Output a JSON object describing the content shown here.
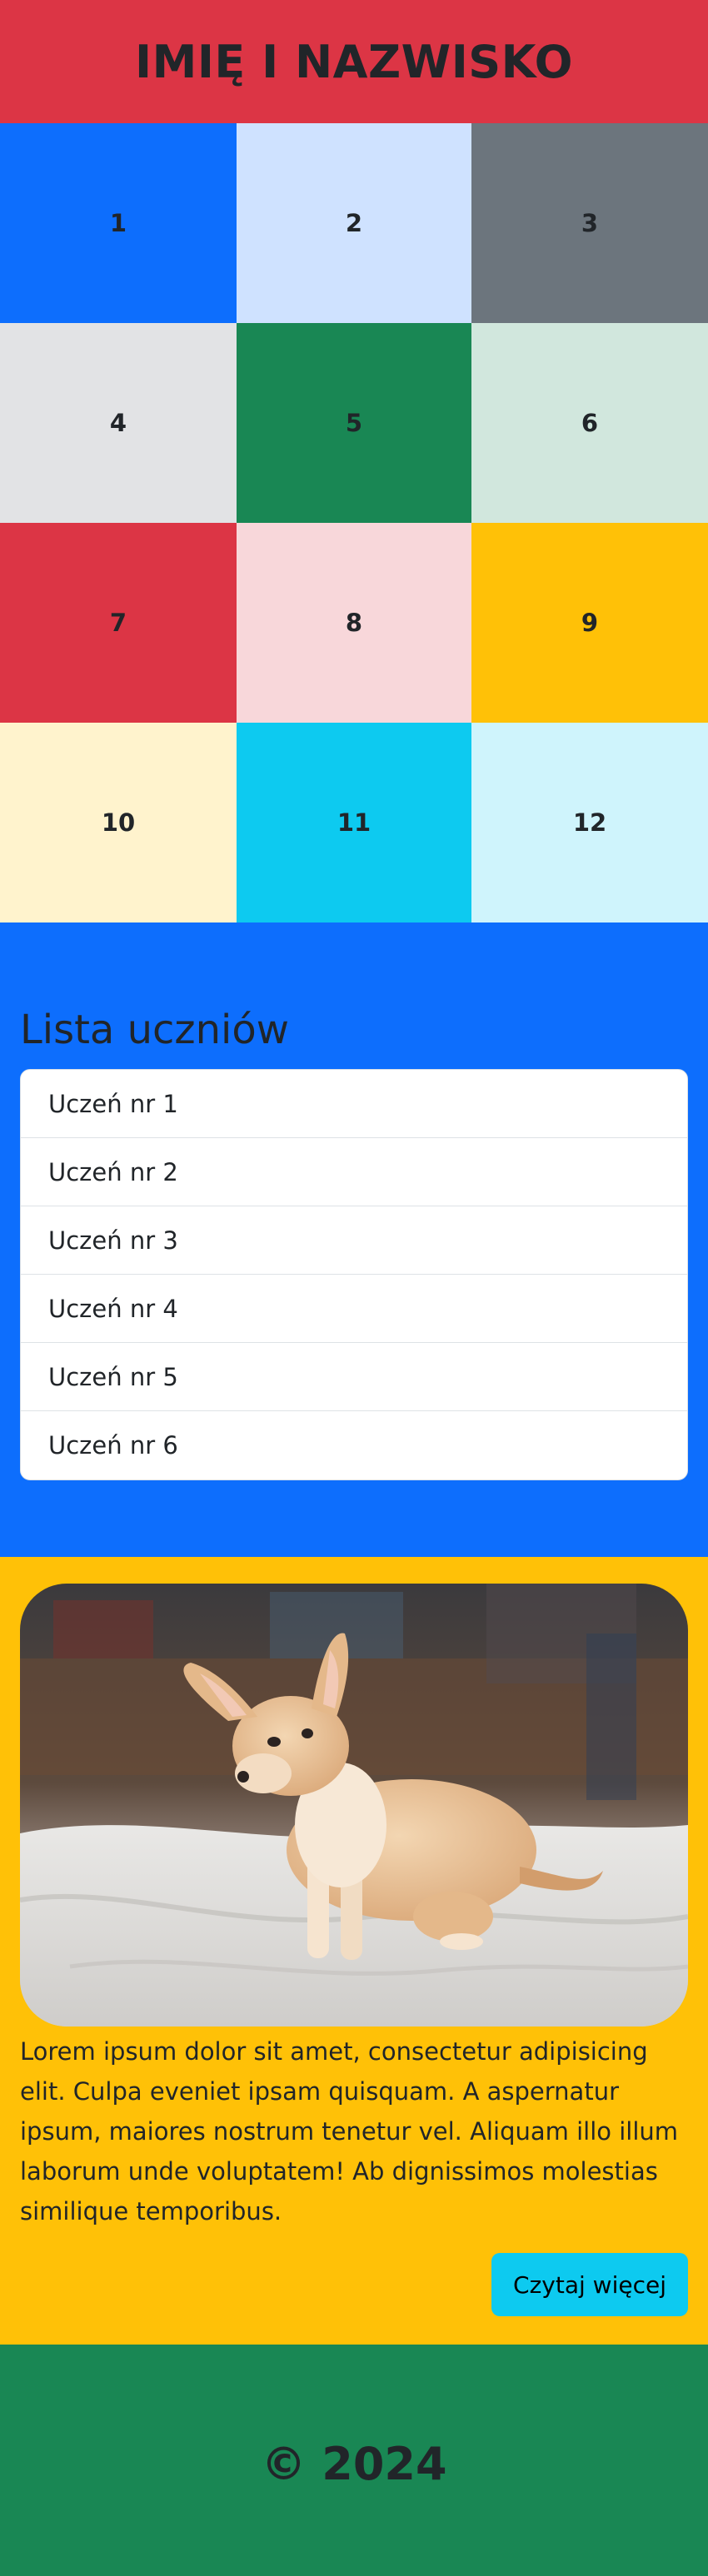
{
  "header": {
    "title": "IMIĘ I NAZWISKO"
  },
  "grid": {
    "cells": [
      {
        "label": "1",
        "color": "#0d6efd"
      },
      {
        "label": "2",
        "color": "#cfe2ff"
      },
      {
        "label": "3",
        "color": "#6c757d"
      },
      {
        "label": "4",
        "color": "#e2e3e5"
      },
      {
        "label": "5",
        "color": "#198754"
      },
      {
        "label": "6",
        "color": "#d1e7dd"
      },
      {
        "label": "7",
        "color": "#dc3545"
      },
      {
        "label": "8",
        "color": "#f8d7da"
      },
      {
        "label": "9",
        "color": "#ffc107"
      },
      {
        "label": "10",
        "color": "#fff3cd"
      },
      {
        "label": "11",
        "color": "#0dcaf0"
      },
      {
        "label": "12",
        "color": "#cff4fc"
      }
    ]
  },
  "students": {
    "heading": "Lista uczniów",
    "items": [
      "Uczeń nr 1",
      "Uczeń nr 2",
      "Uczeń nr 3",
      "Uczeń nr 4",
      "Uczeń nr 5",
      "Uczeń nr 6"
    ]
  },
  "card": {
    "image_subject": "chihuahua-puppy-on-bed",
    "text": "Lorem ipsum dolor sit amet, consectetur adipisicing elit. Culpa eveniet ipsam quisquam. A aspernatur ipsum, maiores nostrum tenetur vel. Aliquam illo illum laborum unde voluptatem! Ab dignissimos molestias similique temporibus.",
    "button_label": "Czytaj więcej"
  },
  "footer": {
    "text": "© 2024"
  }
}
